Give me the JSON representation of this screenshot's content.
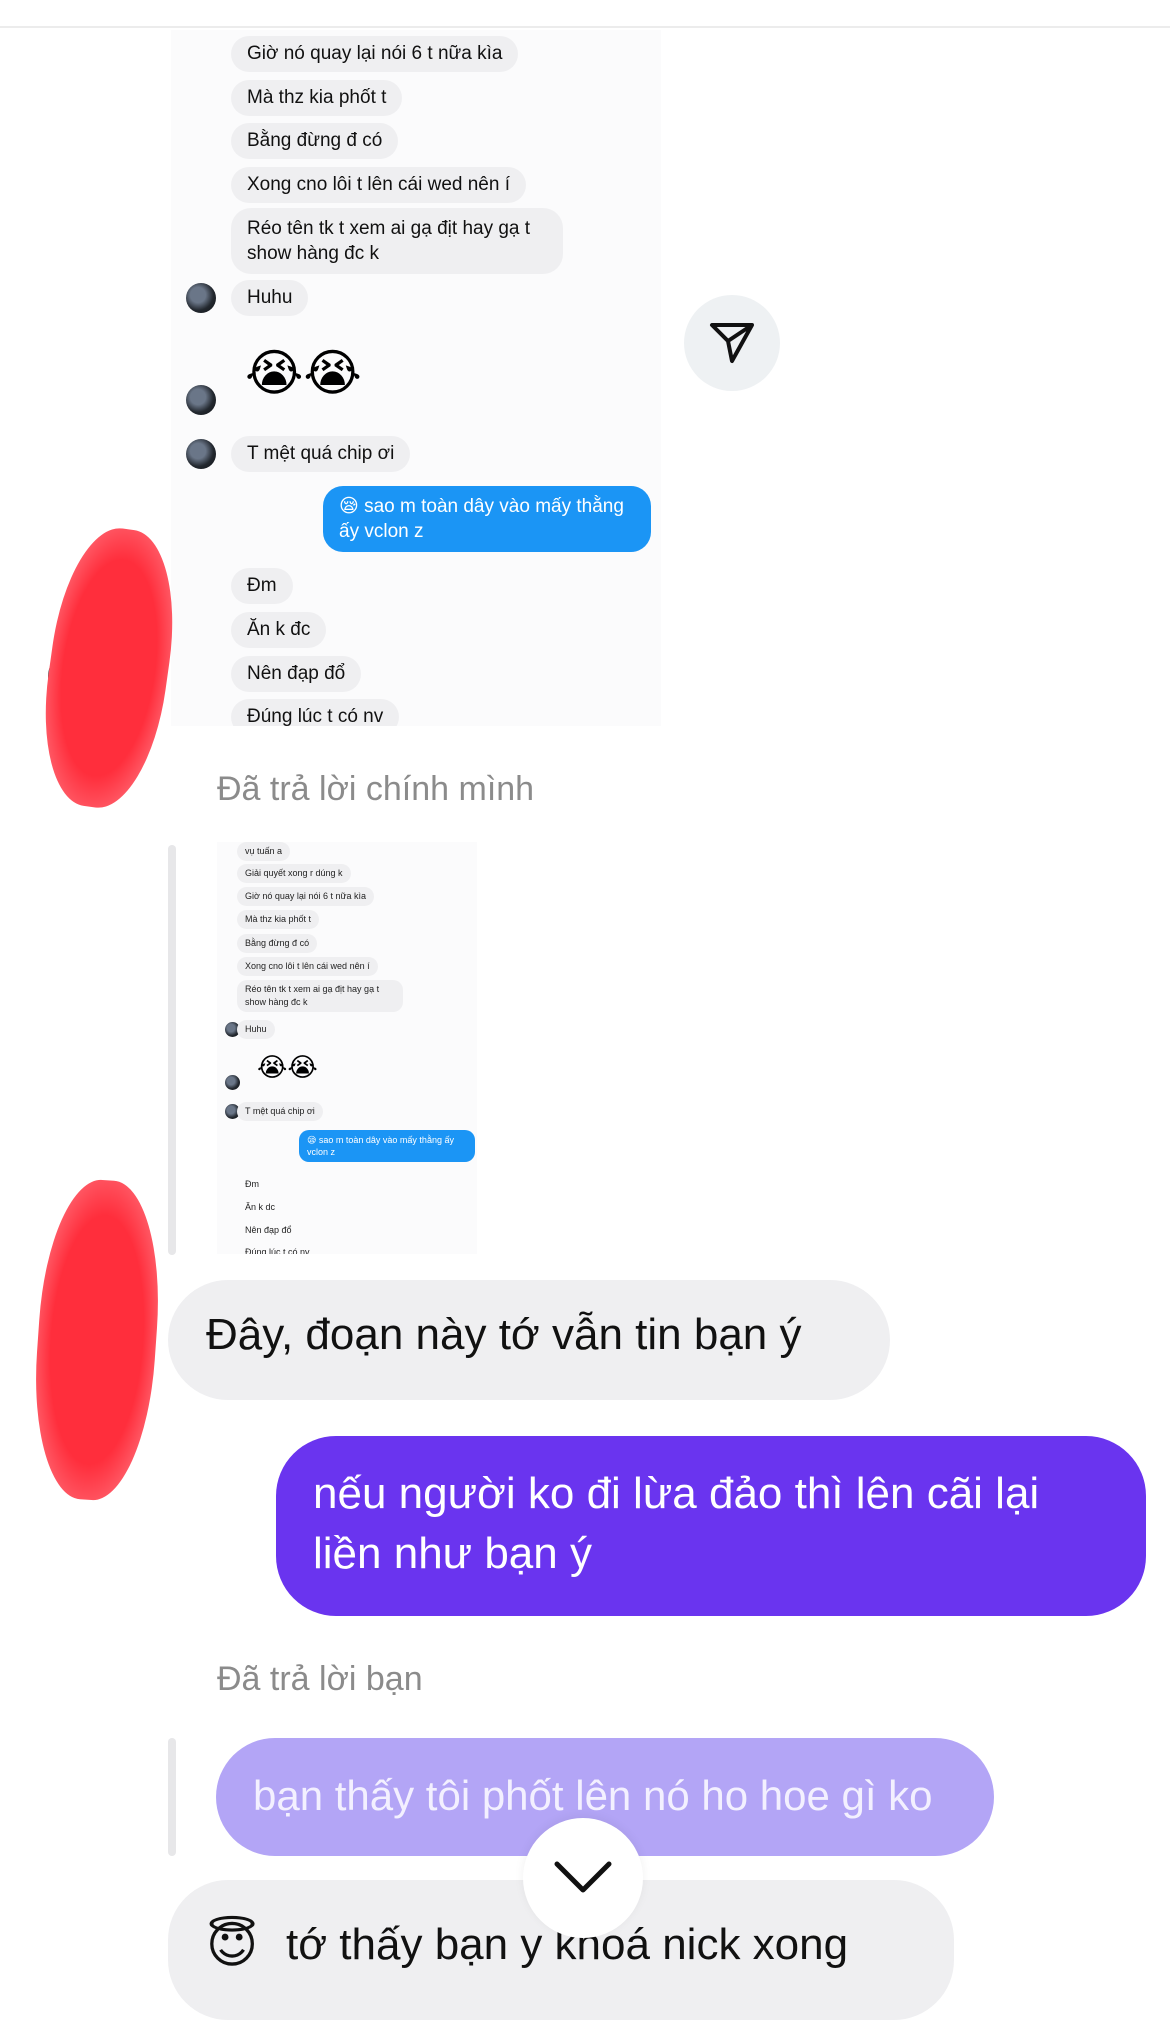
{
  "thread_screenshot_top": {
    "messages": [
      {
        "kind": "in",
        "text": "Giờ nó quay lại nói 6 t nữa kìa"
      },
      {
        "kind": "in",
        "text": "Mà thz kia phốt t"
      },
      {
        "kind": "in",
        "text": "Bằng đừng đ có"
      },
      {
        "kind": "in",
        "text": "Xong cno lôi t lên cái wed nên í"
      },
      {
        "kind": "in",
        "text": "Réo tên tk t xem ai gạ địt hay gạ t show hàng đc k"
      },
      {
        "kind": "in",
        "text": "Huhu"
      },
      {
        "kind": "emoji",
        "text": "😭😭"
      },
      {
        "kind": "in",
        "text": "T mệt quá chip ơi"
      },
      {
        "kind": "out",
        "text": "😪 sao m toàn dây vào mấy thằng ấy vclon z"
      },
      {
        "kind": "in",
        "text": "Đm"
      },
      {
        "kind": "in",
        "text": "Ăn k đc"
      },
      {
        "kind": "in",
        "text": "Nên đạp đổ"
      },
      {
        "kind": "in",
        "text": "Đúng lúc t có nv"
      }
    ]
  },
  "reply_label_self": "Đã trả lời chính mình",
  "thread_screenshot_small": {
    "messages": [
      {
        "kind": "in",
        "text": "vụ tuấn a"
      },
      {
        "kind": "in",
        "text": "Giải quyết xong r dúng k"
      },
      {
        "kind": "in",
        "text": "Giờ nó quay lại nói 6 t nữa kìa"
      },
      {
        "kind": "in",
        "text": "Mà thz kia phốt t"
      },
      {
        "kind": "in",
        "text": "Bằng đừng đ có"
      },
      {
        "kind": "in",
        "text": "Xong cno lôi t lên cái wed nên í"
      },
      {
        "kind": "in",
        "text": "Réo tên tk t xem ai gạ địt hay gạ t show hàng đc k"
      },
      {
        "kind": "in",
        "text": "Huhu"
      },
      {
        "kind": "emoji",
        "text": "😭😭"
      },
      {
        "kind": "in",
        "text": "T mệt quá chip ơi"
      },
      {
        "kind": "out",
        "text": "😪 sao m toàn dây vào mấy thằng ấy vclon z"
      },
      {
        "kind": "in",
        "text": "Đm"
      },
      {
        "kind": "in",
        "text": "Ăn k dc"
      },
      {
        "kind": "in",
        "text": "Nên đạp đổ"
      },
      {
        "kind": "in",
        "text": "Đúng lúc t có nv"
      }
    ]
  },
  "conversation": {
    "incoming_1": "Đây, đoạn này tớ vẫn tin bạn ý",
    "outgoing_1": "nếu người ko đi lừa đảo thì lên cãi lại liền như bạn ý",
    "reply_label_you": "Đã trả lời bạn",
    "quoted_reply": "bạn thấy tôi phốt lên nó ho hoe gì ko",
    "incoming_2_emoji": "😇",
    "incoming_2": "tớ thấy bạn y khoá nick xong"
  },
  "icons": {
    "send": "send-icon",
    "scroll_down": "chevron-down-icon"
  },
  "colors": {
    "outgoing_bubble": "#6a34ef",
    "quoted_bubble": "#b3a5f6",
    "incoming_bubble": "#efeff1",
    "embedded_outgoing": "#1b95f5",
    "label_gray": "#8b8b8b"
  }
}
